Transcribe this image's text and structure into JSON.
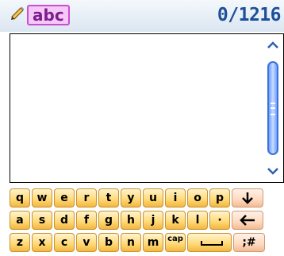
{
  "header": {
    "mode_label": "abc",
    "counter": "0/1216"
  },
  "editor": {
    "text": ""
  },
  "keyboard": {
    "row1": [
      "q",
      "w",
      "e",
      "r",
      "t",
      "y",
      "u",
      "i",
      "o",
      "p"
    ],
    "row2": [
      "a",
      "s",
      "d",
      "f",
      "g",
      "h",
      "j",
      "k",
      "l",
      "·"
    ],
    "row3": [
      "z",
      "x",
      "c",
      "v",
      "b",
      "n",
      "m"
    ],
    "caps_label": "cap",
    "symbols_label": ";#"
  },
  "icons": {
    "edit": "pencil-icon",
    "scroll_up": "chevron-up-icon",
    "scroll_down": "chevron-down-icon",
    "enter": "arrow-down-icon",
    "backspace": "arrow-left-icon",
    "space": "space-icon"
  },
  "colors": {
    "mode_badge_bg": "#f6c8f8",
    "mode_badge_border": "#c74fd0",
    "counter": "#1d4f9a",
    "key_fill": "#ffd874",
    "func_key_fill": "#ffd9bf",
    "scroll_thumb": "#6fa0ff"
  }
}
